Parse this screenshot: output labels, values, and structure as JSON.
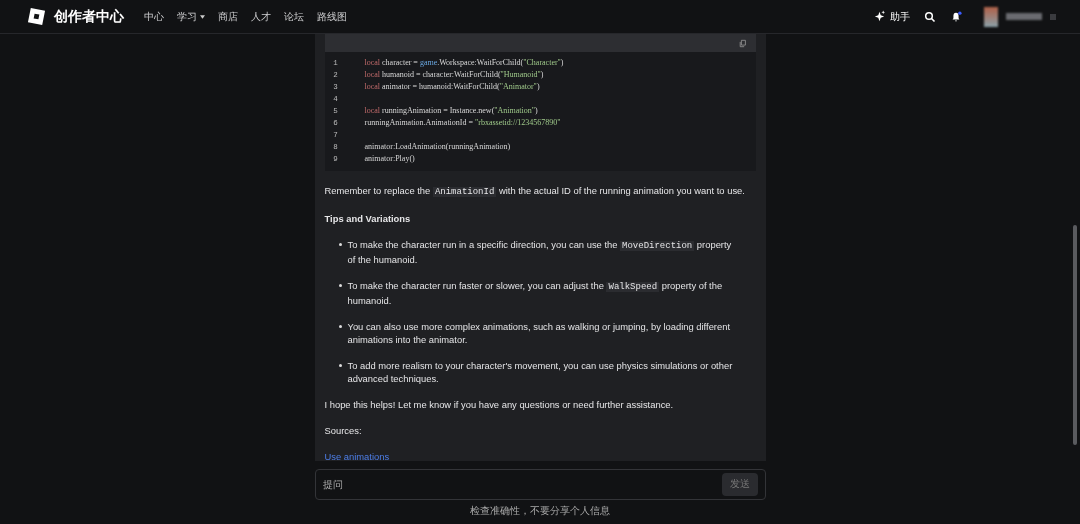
{
  "header": {
    "logo_text": "创作者中心",
    "nav": [
      {
        "label": "中心",
        "dropdown": false
      },
      {
        "label": "学习",
        "dropdown": true
      },
      {
        "label": "商店",
        "dropdown": false
      },
      {
        "label": "人才",
        "dropdown": false
      },
      {
        "label": "论坛",
        "dropdown": false
      },
      {
        "label": "路线图",
        "dropdown": false
      }
    ],
    "assistant_label": "助手",
    "notification_unread": true
  },
  "code": {
    "line_numbers": [
      "1",
      "2",
      "3",
      "4",
      "5",
      "6",
      "7",
      "8",
      "9"
    ],
    "lines": [
      [
        {
          "kind": "keyword",
          "text": "local"
        },
        {
          "kind": "plain",
          "text": " character = "
        },
        {
          "kind": "global",
          "text": "game"
        },
        {
          "kind": "plain",
          "text": ".Workspace:WaitForChild("
        },
        {
          "kind": "string",
          "text": "\"Character\""
        },
        {
          "kind": "plain",
          "text": ")"
        }
      ],
      [
        {
          "kind": "keyword",
          "text": "local"
        },
        {
          "kind": "plain",
          "text": " humanoid = character:WaitForChild("
        },
        {
          "kind": "string",
          "text": "\"Humanoid\""
        },
        {
          "kind": "plain",
          "text": ")"
        }
      ],
      [
        {
          "kind": "keyword",
          "text": "local"
        },
        {
          "kind": "plain",
          "text": " animator = humanoid:WaitForChild("
        },
        {
          "kind": "string",
          "text": "\"Animator\""
        },
        {
          "kind": "plain",
          "text": ")"
        }
      ],
      [
        {
          "kind": "blank"
        }
      ],
      [
        {
          "kind": "keyword",
          "text": "local"
        },
        {
          "kind": "plain",
          "text": " runningAnimation = Instance.new("
        },
        {
          "kind": "string",
          "text": "\"Animation\""
        },
        {
          "kind": "plain",
          "text": ")"
        }
      ],
      [
        {
          "kind": "plain",
          "text": "runningAnimation.AnimationId = "
        },
        {
          "kind": "string",
          "text": "\"rbxassetid://1234567890\""
        }
      ],
      [
        {
          "kind": "blank"
        }
      ],
      [
        {
          "kind": "plain",
          "text": "animator:LoadAnimation(runningAnimation)"
        }
      ],
      [
        {
          "kind": "plain",
          "text": "animator:Play()"
        }
      ]
    ]
  },
  "answer": [
    {
      "kind": "paragraph",
      "parts": [
        {
          "kind": "text",
          "text": "Remember to replace the "
        },
        {
          "kind": "code",
          "text": "AnimationId"
        },
        {
          "kind": "text",
          "text": " with the actual ID of the running animation you want to use."
        }
      ]
    },
    {
      "kind": "heading",
      "text": "Tips and Variations"
    },
    {
      "kind": "bullet",
      "parts": [
        {
          "kind": "text",
          "text": "To make the character run in a specific direction, you can use the "
        },
        {
          "kind": "code",
          "text": "MoveDirection"
        },
        {
          "kind": "text",
          "text": " property of the humanoid."
        }
      ]
    },
    {
      "kind": "bullet",
      "parts": [
        {
          "kind": "text",
          "text": "To make the character run faster or slower, you can adjust the "
        },
        {
          "kind": "code",
          "text": "WalkSpeed"
        },
        {
          "kind": "text",
          "text": " property of the humanoid."
        }
      ]
    },
    {
      "kind": "bullet",
      "parts": [
        {
          "kind": "text",
          "text": "You can also use more complex animations, such as walking or jumping, by loading different animations into the animator."
        }
      ]
    },
    {
      "kind": "bullet",
      "parts": [
        {
          "kind": "text",
          "text": "To add more realism to your character's movement, you can use physics simulations or other advanced techniques."
        }
      ]
    },
    {
      "kind": "paragraph",
      "parts": [
        {
          "kind": "text",
          "text": "I hope this helps! Let me know if you have any questions or need further assistance."
        }
      ]
    },
    {
      "kind": "paragraph",
      "parts": [
        {
          "kind": "text",
          "text": "Sources:"
        }
      ]
    },
    {
      "kind": "link",
      "text": "Use animations"
    }
  ],
  "composer": {
    "placeholder": "提问",
    "send_label": "发送"
  },
  "disclaimer": "检查准确性，不要分享个人信息"
}
